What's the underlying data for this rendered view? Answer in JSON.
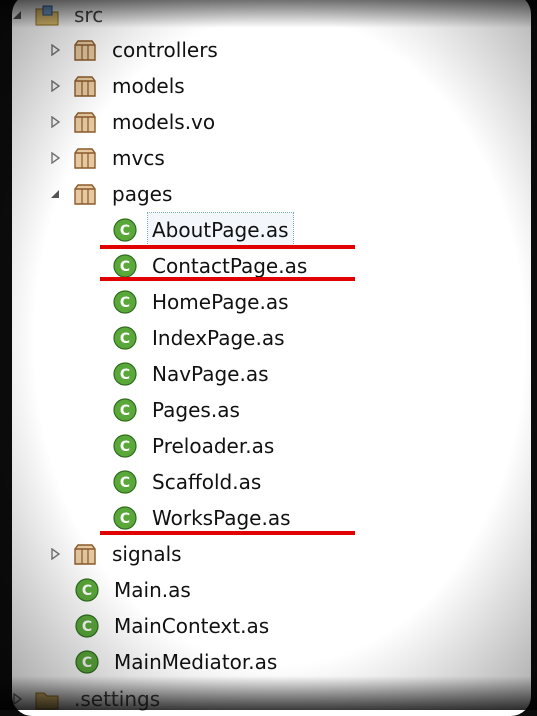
{
  "tree": {
    "src": {
      "label": "src",
      "icon": "package-folder-icon"
    },
    "packages": [
      {
        "label": "controllers"
      },
      {
        "label": "models"
      },
      {
        "label": "models.vo"
      },
      {
        "label": "mvcs"
      }
    ],
    "pages": {
      "label": "pages",
      "files": [
        {
          "label": "AboutPage.as"
        },
        {
          "label": "ContactPage.as"
        },
        {
          "label": "HomePage.as"
        },
        {
          "label": "IndexPage.as"
        },
        {
          "label": "NavPage.as"
        },
        {
          "label": "Pages.as"
        },
        {
          "label": "Preloader.as"
        },
        {
          "label": "Scaffold.as"
        },
        {
          "label": "WorksPage.as"
        }
      ]
    },
    "signals": {
      "label": "signals"
    },
    "root_files": [
      {
        "label": "Main.as"
      },
      {
        "label": "MainContext.as"
      },
      {
        "label": "MainMediator.as"
      }
    ],
    "settings": {
      "label": ".settings"
    }
  },
  "annotations": {
    "color": "#e00000",
    "underlined_files": [
      "AboutPage.as",
      "ContactPage.as",
      "WorksPage.as"
    ]
  }
}
